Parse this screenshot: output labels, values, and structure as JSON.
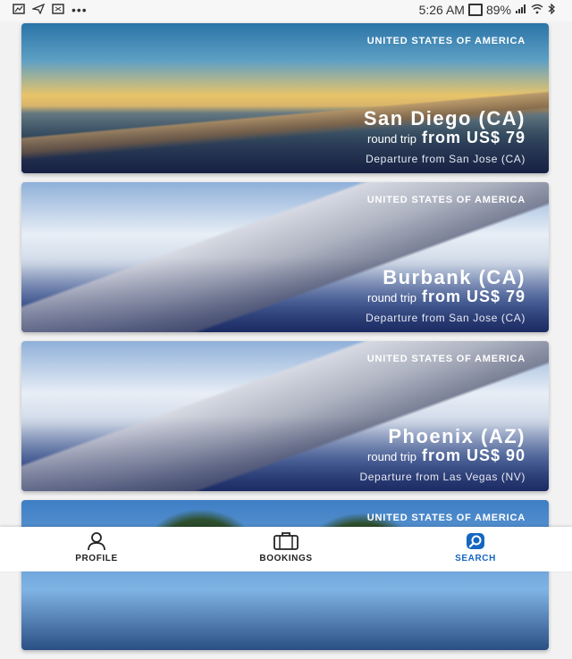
{
  "status_bar": {
    "time": "5:26 AM",
    "battery": "89%",
    "icons": [
      "screenshot-icon",
      "send-icon",
      "cast-icon",
      "more-dots-icon",
      "bluetooth-icon",
      "wifi-icon",
      "signal-icon"
    ]
  },
  "destinations": [
    {
      "country": "UNITED STATES OF AMERICA",
      "city": "San Diego (CA)",
      "price": "from US$ 79",
      "trip_type": "round trip",
      "departure": "Departure from San Jose (CA)"
    },
    {
      "country": "UNITED STATES OF AMERICA",
      "city": "Burbank (CA)",
      "price": "from US$ 79",
      "trip_type": "round trip",
      "departure": "Departure from San Jose (CA)"
    },
    {
      "country": "UNITED STATES OF AMERICA",
      "city": "Phoenix (AZ)",
      "price": "from US$ 90",
      "trip_type": "round trip",
      "departure": "Departure from Las Vegas (NV)"
    },
    {
      "country": "UNITED STATES OF AMERICA"
    }
  ],
  "bottom_nav": {
    "items": [
      {
        "label": "SEARCH",
        "icon": "search-icon",
        "active": true
      },
      {
        "label": "BOOKINGS",
        "icon": "briefcase-icon",
        "active": false
      },
      {
        "label": "PROFILE",
        "icon": "person-icon",
        "active": false
      }
    ],
    "active_color": "#1566c0"
  }
}
